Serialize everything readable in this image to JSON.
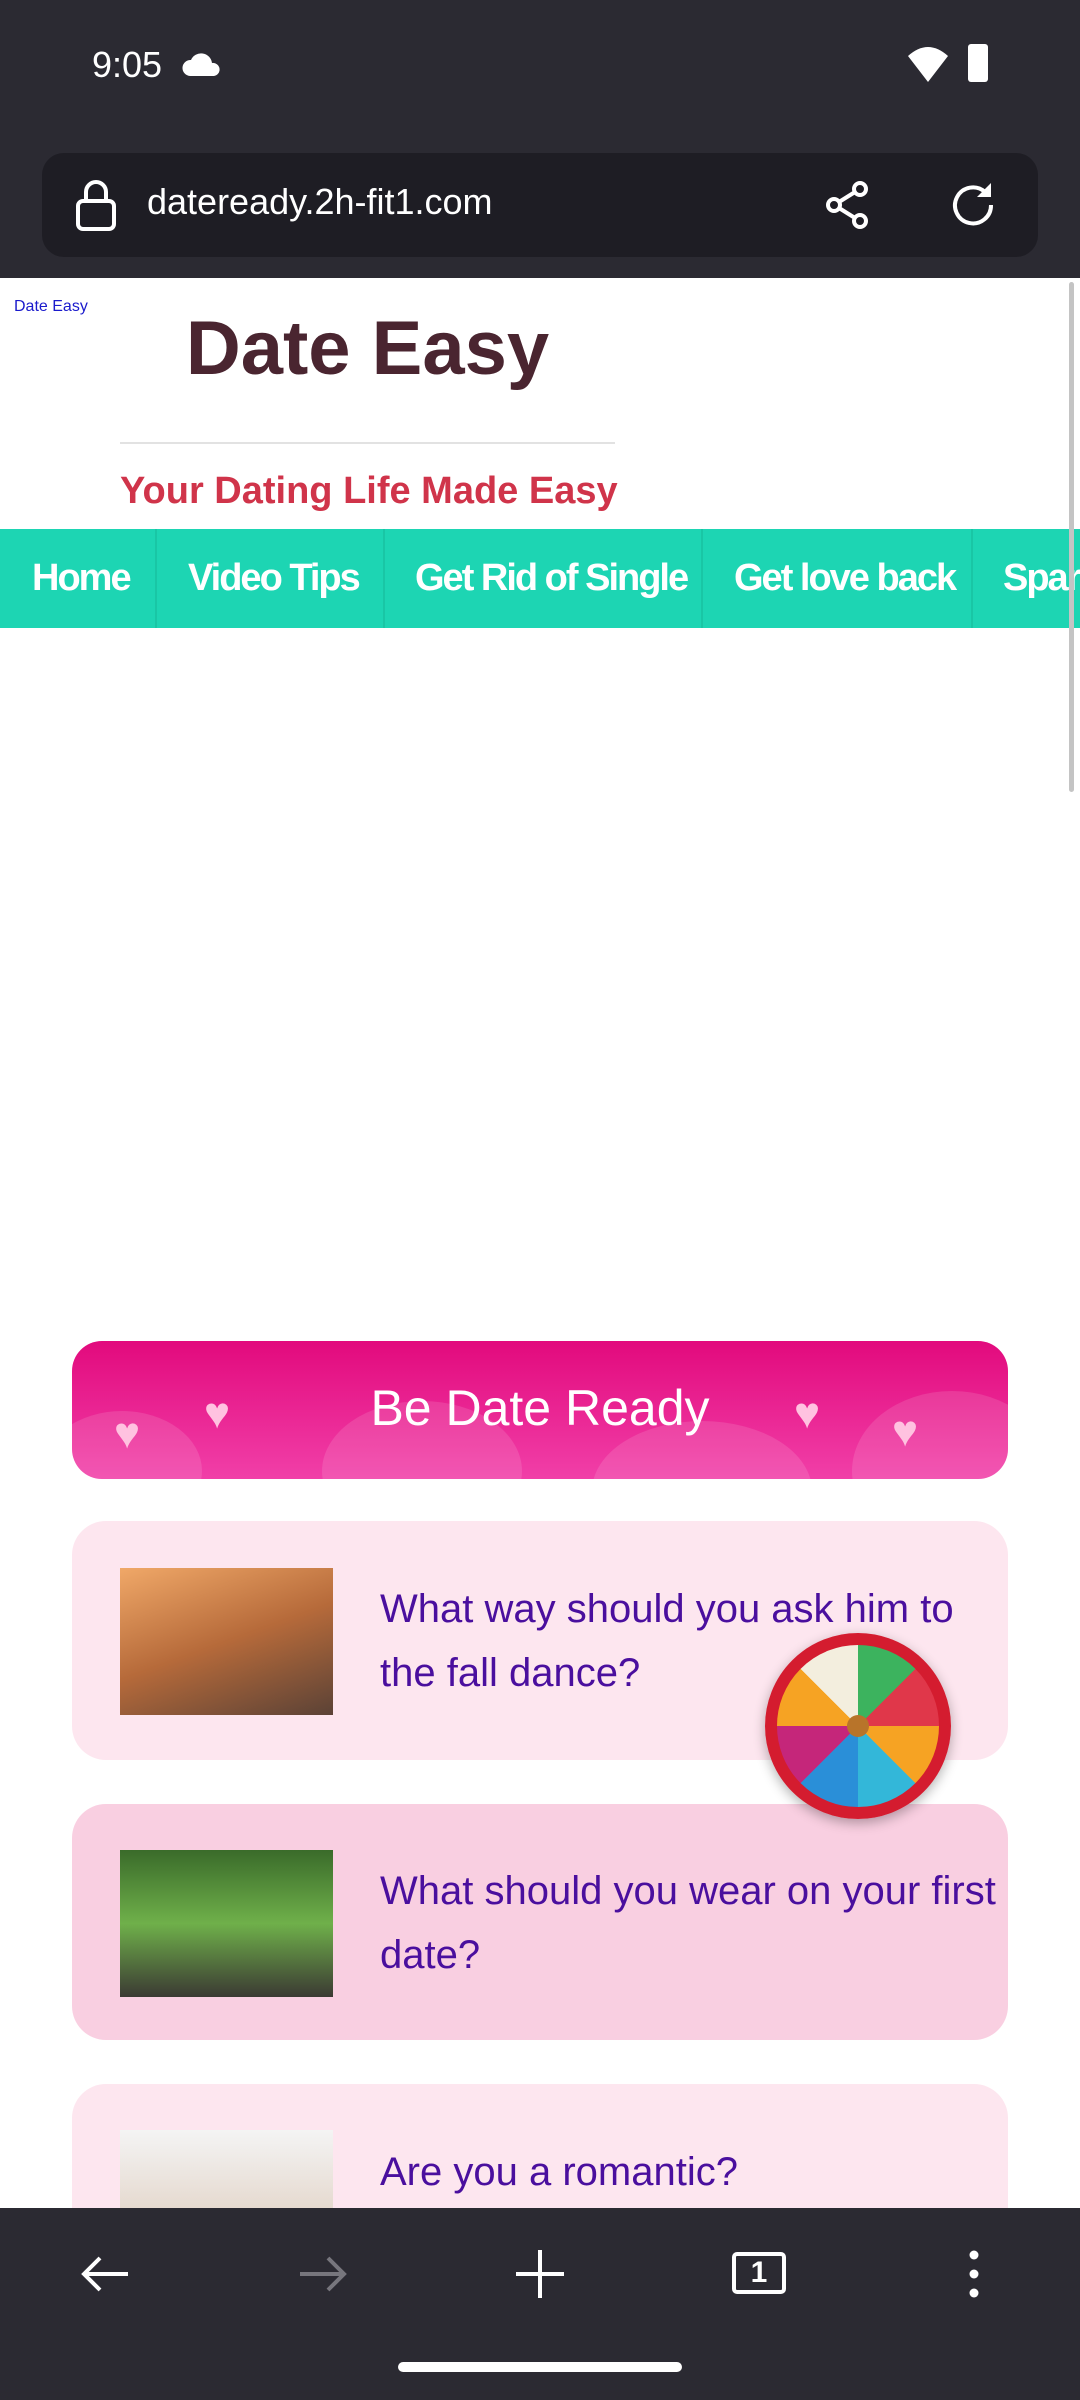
{
  "status_bar": {
    "time": "9:05"
  },
  "browser": {
    "url": "dateready.2h-fit1.com",
    "tab_count": "1"
  },
  "site": {
    "small_brand": "Date Easy",
    "title": "Date Easy",
    "tagline": "Your Dating Life Made Easy",
    "nav": [
      "Home",
      "Video Tips",
      "Get Rid of Single",
      "Get love back",
      "Spar"
    ]
  },
  "banner": {
    "title": "Be Date Ready"
  },
  "articles": [
    {
      "title": "What way should you ask him to the fall dance?"
    },
    {
      "title": "What should you wear on your first date?"
    },
    {
      "title": "Are you a romantic?"
    }
  ],
  "colors": {
    "nav": "#1dd5b3",
    "title": "#4a2530",
    "tagline": "#d0344a",
    "link": "#4a0f9e"
  }
}
